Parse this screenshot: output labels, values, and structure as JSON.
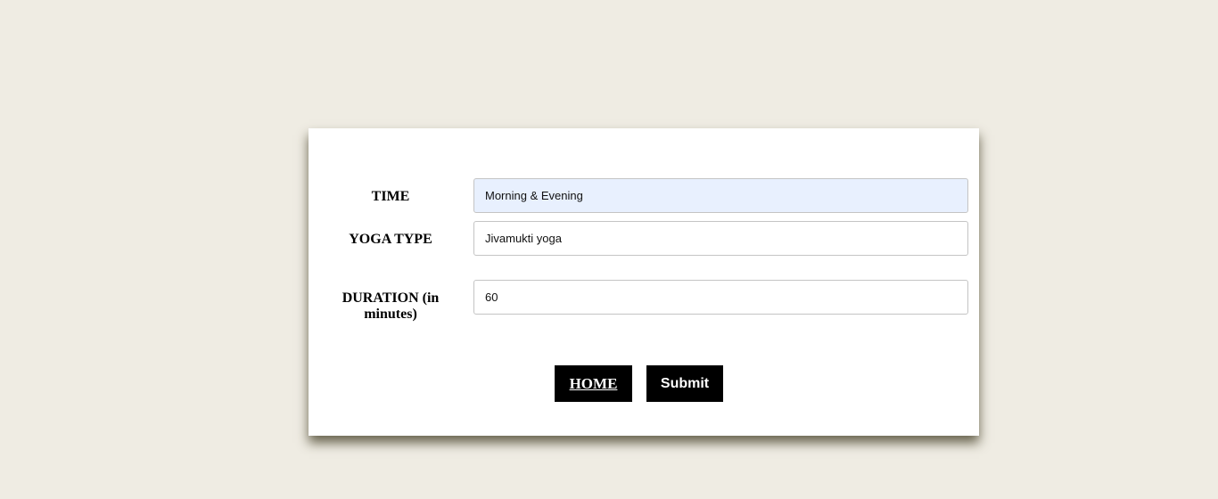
{
  "form": {
    "time": {
      "label": "TIME",
      "value": "Morning & Evening"
    },
    "yoga_type": {
      "label": "YOGA TYPE",
      "value": "Jivamukti yoga"
    },
    "duration": {
      "label_line1": "DURATION (in",
      "label_line2": "minutes)",
      "value": "60"
    },
    "home_label": "HOME ",
    "submit_label": "Submit"
  }
}
